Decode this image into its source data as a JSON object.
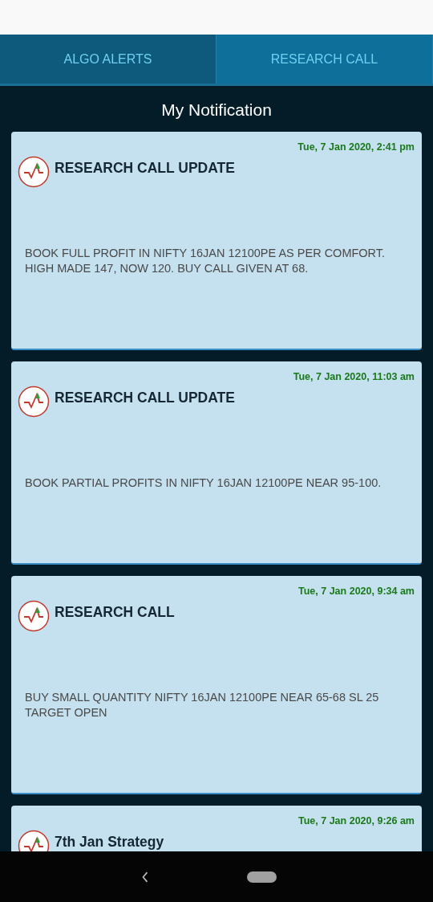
{
  "tabs": [
    {
      "label": "ALGO ALERTS",
      "selected": false
    },
    {
      "label": "RESEARCH CALL",
      "selected": true
    }
  ],
  "heading": "My Notification",
  "notifications": [
    {
      "date": "Tue, 7 Jan 2020, 2:41 pm",
      "title": "RESEARCH CALL UPDATE",
      "body": "BOOK FULL PROFIT IN NIFTY 16JAN 12100PE AS PER COMFORT. HIGH MADE 147, NOW 120. BUY CALL GIVEN AT 68."
    },
    {
      "date": "Tue, 7 Jan 2020, 11:03 am",
      "title": "RESEARCH CALL UPDATE",
      "body": "BOOK PARTIAL PROFITS IN NIFTY 16JAN 12100PE NEAR 95-100."
    },
    {
      "date": "Tue, 7 Jan 2020, 9:34 am",
      "title": "RESEARCH CALL",
      "body": "BUY SMALL QUANTITY NIFTY 16JAN 12100PE NEAR 65-68 SL 25 TARGET OPEN"
    },
    {
      "date": "Tue, 7 Jan 2020, 9:26 am",
      "title": "7th Jan Strategy"
    }
  ]
}
